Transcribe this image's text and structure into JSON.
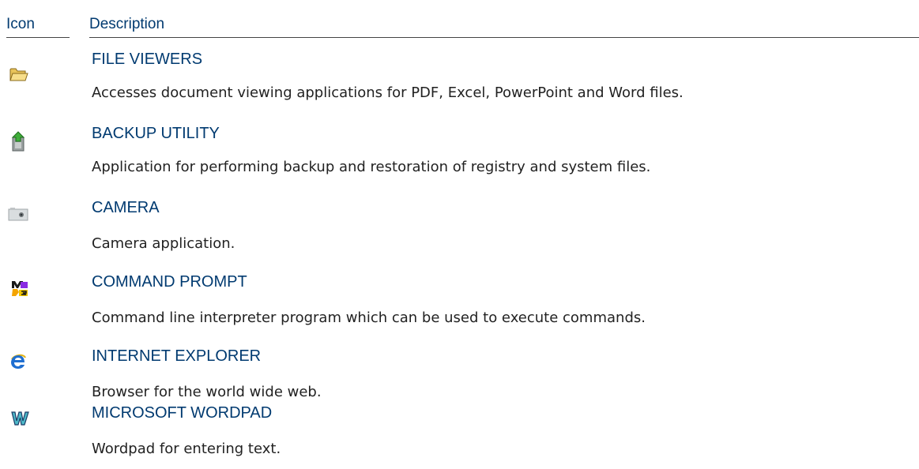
{
  "header": {
    "icon_label": "Icon",
    "description_label": "Description"
  },
  "colors": {
    "heading": "#003a70",
    "body_text": "#222222",
    "rule": "#444444"
  },
  "rows": [
    {
      "icon": "folder-icon",
      "title": "FILE VIEWERS",
      "description": "Accesses document viewing applications for PDF, Excel, PowerPoint and Word files."
    },
    {
      "icon": "backup-icon",
      "title": "BACKUP UTILITY",
      "description": "Application for performing backup and restoration of registry and system files."
    },
    {
      "icon": "camera-icon",
      "title": "CAMERA",
      "description": "Camera application."
    },
    {
      "icon": "command-prompt-icon",
      "title": "COMMAND PROMPT",
      "description": "Command line interpreter program which can be used to execute commands."
    },
    {
      "icon": "internet-explorer-icon",
      "title": "INTERNET EXPLORER",
      "description": "Browser for the world wide web."
    },
    {
      "icon": "wordpad-icon",
      "title": "MICROSOFT WORDPAD",
      "description": "Wordpad for entering text."
    }
  ]
}
